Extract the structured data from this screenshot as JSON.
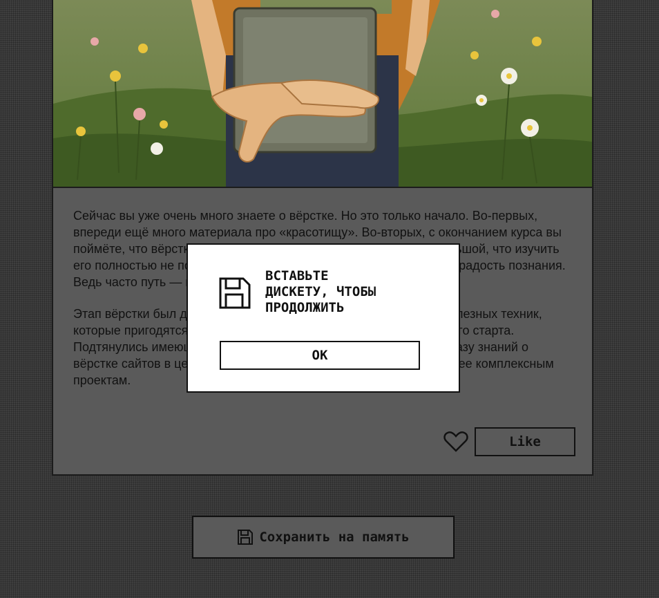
{
  "article": {
    "paragraph_1": "Сейчас вы уже очень много знаете о вёрстке. Но это только начало. Во-первых, впереди ещё много материала про «красотищу». Во-вторых, с окончанием курса вы поймёте, что вёрстка — это целый мир. И этот мир настолько большой, что изучить его полностью не получится, но это и не страшно — в этом и есть радость познания. Ведь часто путь — и есть цель.",
    "paragraph_2": "Этап вёрстки был для меня интересным и насыщенным: много полезных техник, которые пригодятся в работе. Отличный фундамент для уверенного старта. Подтянулись имеющиеся навыки, расширила инструментарий и базу знаний о вёрстке сайтов в целом. Готова двигаться дальше — к новым, более комплексным проектам."
  },
  "like": {
    "label": "Like",
    "heart_icon": "heart-outline-icon"
  },
  "save": {
    "label": "Сохранить на память",
    "icon": "floppy-disk-icon"
  },
  "modal": {
    "message": "ВСТАВЬТЕ\nДИСКЕТУ, ЧТОБЫ\nПРОДОЛЖИТЬ",
    "ok_label": "OK",
    "icon": "floppy-disk-icon"
  }
}
